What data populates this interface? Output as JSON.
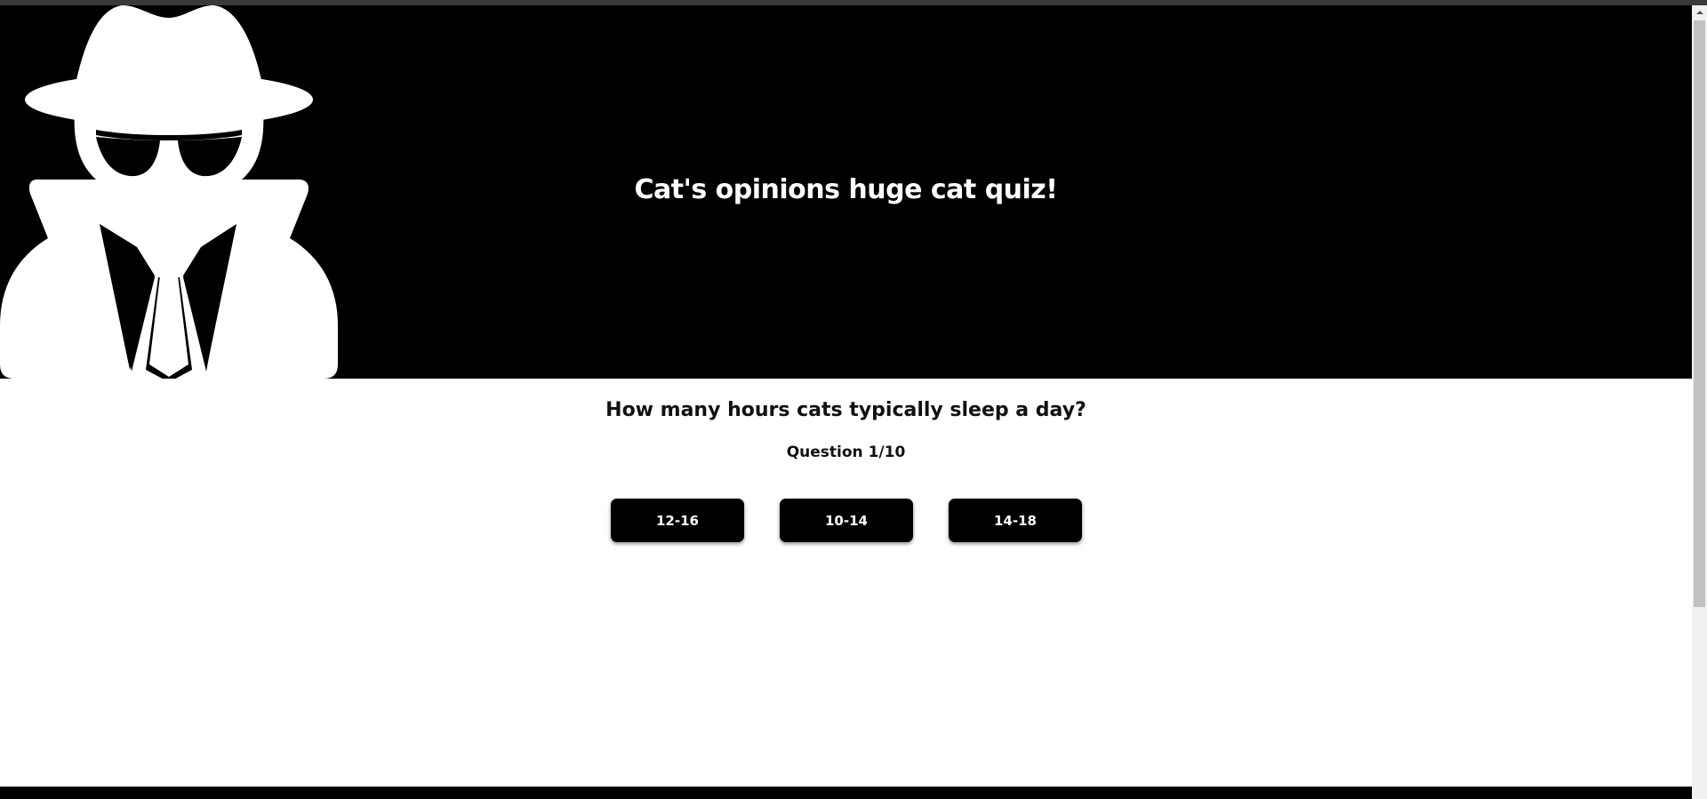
{
  "header": {
    "title": "Cat's opinions huge cat quiz!",
    "logo_icon": "spy-icon"
  },
  "quiz": {
    "question": "How many hours cats typically sleep a day?",
    "counter": "Question 1/10",
    "answers": [
      {
        "label": "12-16"
      },
      {
        "label": "10-14"
      },
      {
        "label": "14-18"
      }
    ]
  },
  "colors": {
    "hero_background": "#000000",
    "button_background": "#000000",
    "button_text": "#ffffff",
    "page_background": "#ffffff"
  }
}
